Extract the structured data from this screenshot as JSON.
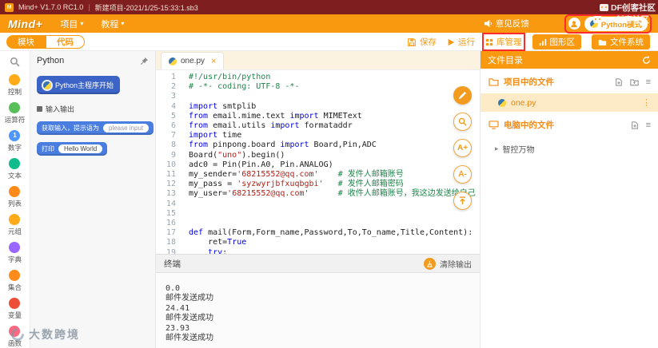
{
  "titlebar": {
    "logo_glyph": "M",
    "app_title": "Mind+ V1.7.0 RC1.0",
    "separator": "|",
    "project_title": "新建项目-2021/1/25-15:33:1.sb3",
    "minimize_glyph": "—",
    "maximize_glyph": "□",
    "close_glyph": "×"
  },
  "menubar": {
    "brand": "Mind+",
    "menu_project": "项目",
    "menu_tutorial": "教程",
    "caret_glyph": "▾",
    "feedback_label": "意见反馈",
    "mode_label": "Python模式"
  },
  "toolbar": {
    "tab_module": "模块",
    "tab_code": "代码",
    "save_label": "保存",
    "run_label": "运行",
    "library_label": "库管理",
    "graphics_label": "图形区",
    "filesystem_label": "文件系统"
  },
  "sidebar": {
    "categories": [
      {
        "label": "控制",
        "color": "#ffab19"
      },
      {
        "label": "运算符",
        "color": "#59c059"
      },
      {
        "label": "数字",
        "color": "#4c97ff",
        "badge": "1"
      },
      {
        "label": "文本",
        "color": "#0fbd8c"
      },
      {
        "label": "列表",
        "color": "#ff8c1a"
      },
      {
        "label": "元组",
        "color": "#ffab19"
      },
      {
        "label": "字典",
        "color": "#9966ff"
      },
      {
        "label": "集合",
        "color": "#ff8c1a"
      },
      {
        "label": "变量",
        "color": "#ee4d38"
      },
      {
        "label": "函数",
        "color": "#ff6680"
      }
    ]
  },
  "palette": {
    "header": "Python",
    "hat_block": "Python主程序开始",
    "section_label": "输入输出",
    "input_block_label": "获取输入，提示语为",
    "input_block_value": "please input",
    "print_block_label": "打印",
    "print_block_value": "Hello World"
  },
  "editor": {
    "tab_name": "one.py",
    "close_glyph": "×",
    "lines": [
      [
        [
          "#!/usr/bin/python",
          "c"
        ]
      ],
      [
        [
          "# -*- coding: UTF-8 -*-",
          "c"
        ]
      ],
      [],
      [
        [
          "import",
          "k"
        ],
        [
          " smtplib",
          "n"
        ]
      ],
      [
        [
          "from",
          "k"
        ],
        [
          " email.mime.text ",
          "n"
        ],
        [
          "import",
          "k"
        ],
        [
          " MIMEText",
          "n"
        ]
      ],
      [
        [
          "from",
          "k"
        ],
        [
          " email.utils ",
          "n"
        ],
        [
          "import",
          "k"
        ],
        [
          " formataddr",
          "n"
        ]
      ],
      [
        [
          "import",
          "k"
        ],
        [
          " time",
          "n"
        ]
      ],
      [
        [
          "from",
          "k"
        ],
        [
          " pinpong.board ",
          "n"
        ],
        [
          "import",
          "k"
        ],
        [
          " Board,Pin,ADC",
          "n"
        ]
      ],
      [
        [
          "Board(",
          "n"
        ],
        [
          "\"uno\"",
          "s"
        ],
        [
          ").begin()",
          "n"
        ]
      ],
      [
        [
          "adc0 = Pin(Pin.A0, Pin.ANALOG)",
          "n"
        ]
      ],
      [
        [
          "my_sender=",
          "n"
        ],
        [
          "'68215552@qq.com'",
          "s"
        ],
        [
          "    ",
          "n"
        ],
        [
          "# 发件人邮箱账号",
          "c"
        ]
      ],
      [
        [
          "my_pass = ",
          "n"
        ],
        [
          "'syzwyrjbfxuqbgbi'",
          "s"
        ],
        [
          "   ",
          "n"
        ],
        [
          "# 发件人邮箱密码",
          "c"
        ]
      ],
      [
        [
          "my_user=",
          "n"
        ],
        [
          "'68215552@qq.com'",
          "s"
        ],
        [
          "      ",
          "n"
        ],
        [
          "# 收件人邮箱账号，我这边发送给自己",
          "c"
        ]
      ],
      [],
      [],
      [],
      [
        [
          "def",
          "k"
        ],
        [
          " mail(Form,Form_name,Password,To,To_name,Title,Content):",
          "n"
        ]
      ],
      [
        [
          "    ret=",
          "n"
        ],
        [
          "True",
          "k"
        ]
      ],
      [
        [
          "    ",
          "n"
        ],
        [
          "try",
          "k"
        ],
        [
          ":",
          "n"
        ]
      ]
    ]
  },
  "float_buttons": {
    "font_increase": "A+",
    "font_decrease": "A-"
  },
  "terminal": {
    "title": "终端",
    "clear_label": "清除输出",
    "lines": [
      "0.0",
      "邮件发送成功",
      "24.41",
      "邮件发送成功",
      "23.93",
      "邮件发送成功"
    ]
  },
  "files": {
    "header": "文件目录",
    "project_group_label": "项目中的文件",
    "active_file": "one.py",
    "computer_group_label": "电脑中的文件",
    "tree_item": "智控万物",
    "menu_glyph": "≡",
    "dots_glyph": "⋮",
    "tree_arrow_glyph": "▸"
  },
  "watermarks": {
    "top_right": "DF创客社区",
    "bottom_left": "大数跨境"
  },
  "colors": {
    "accent": "#f8990f",
    "titlebar": "#7e1e1e",
    "annotation": "#ff2b2b"
  }
}
